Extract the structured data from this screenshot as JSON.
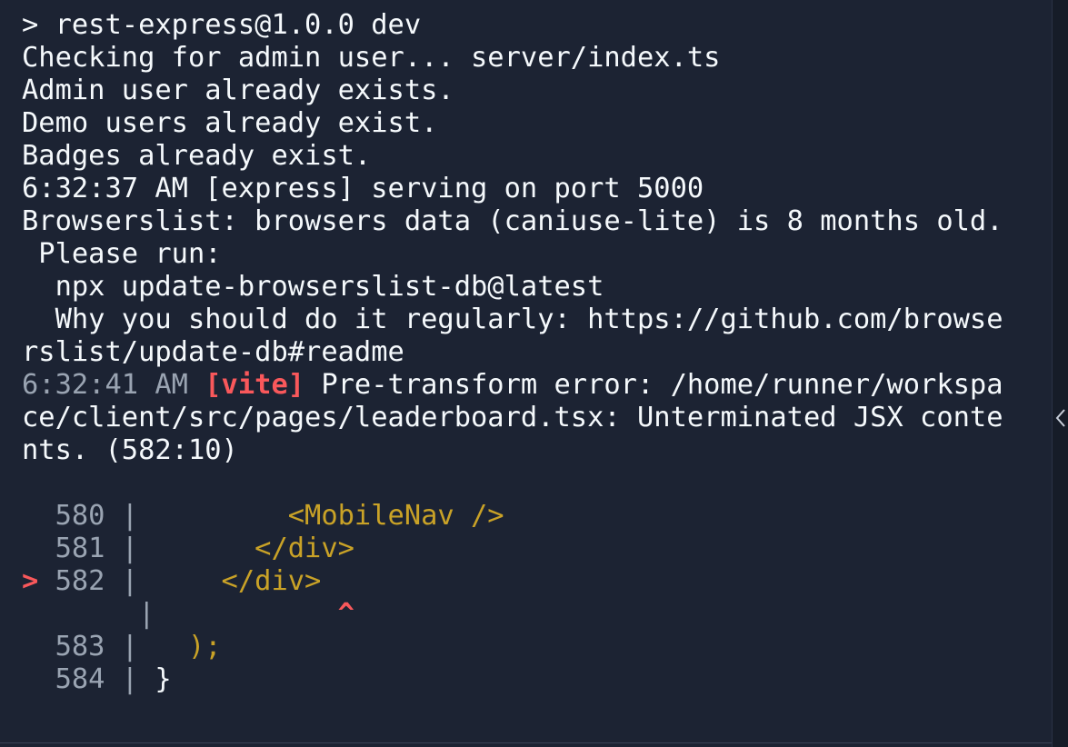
{
  "terminal": {
    "lines": [
      "> rest-express@1.0.0 dev",
      "Checking for admin user... server/index.ts",
      "Admin user already exists.",
      "Demo users already exist.",
      "Badges already exist.",
      "6:32:37 AM [express] serving on port 5000",
      "Browserslist: browsers data (caniuse-lite) is 8 months old.",
      " Please run:",
      "  npx update-browserslist-db@latest",
      "  Why you should do it regularly: https://github.com/browse",
      "rslist/update-db#readme"
    ],
    "error": {
      "time": "6:32:41 AM",
      "tag": "[vite]",
      "message_part1": " Pre-transform error: /home/runner/workspa",
      "message_part2": "ce/client/src/pages/leaderboard.tsx: Unterminated JSX conte",
      "message_part3": "nts. (582:10)"
    },
    "code_frame": [
      {
        "marker": " ",
        "num": "580",
        "sep": " | ",
        "code": "        <MobileNav />"
      },
      {
        "marker": " ",
        "num": "581",
        "sep": " | ",
        "code": "      </div>"
      },
      {
        "marker": ">",
        "num": "582",
        "sep": " | ",
        "code": "    </div>"
      },
      {
        "marker": " ",
        "num": "",
        "sep": "     | ",
        "code": "",
        "caret": "          ^"
      },
      {
        "marker": " ",
        "num": "583",
        "sep": " | ",
        "code": "  );"
      },
      {
        "marker": " ",
        "num": "584",
        "sep": " | ",
        "code": "}"
      }
    ]
  },
  "sidebar": {
    "collapse_icon": "chevron-left-icon"
  }
}
